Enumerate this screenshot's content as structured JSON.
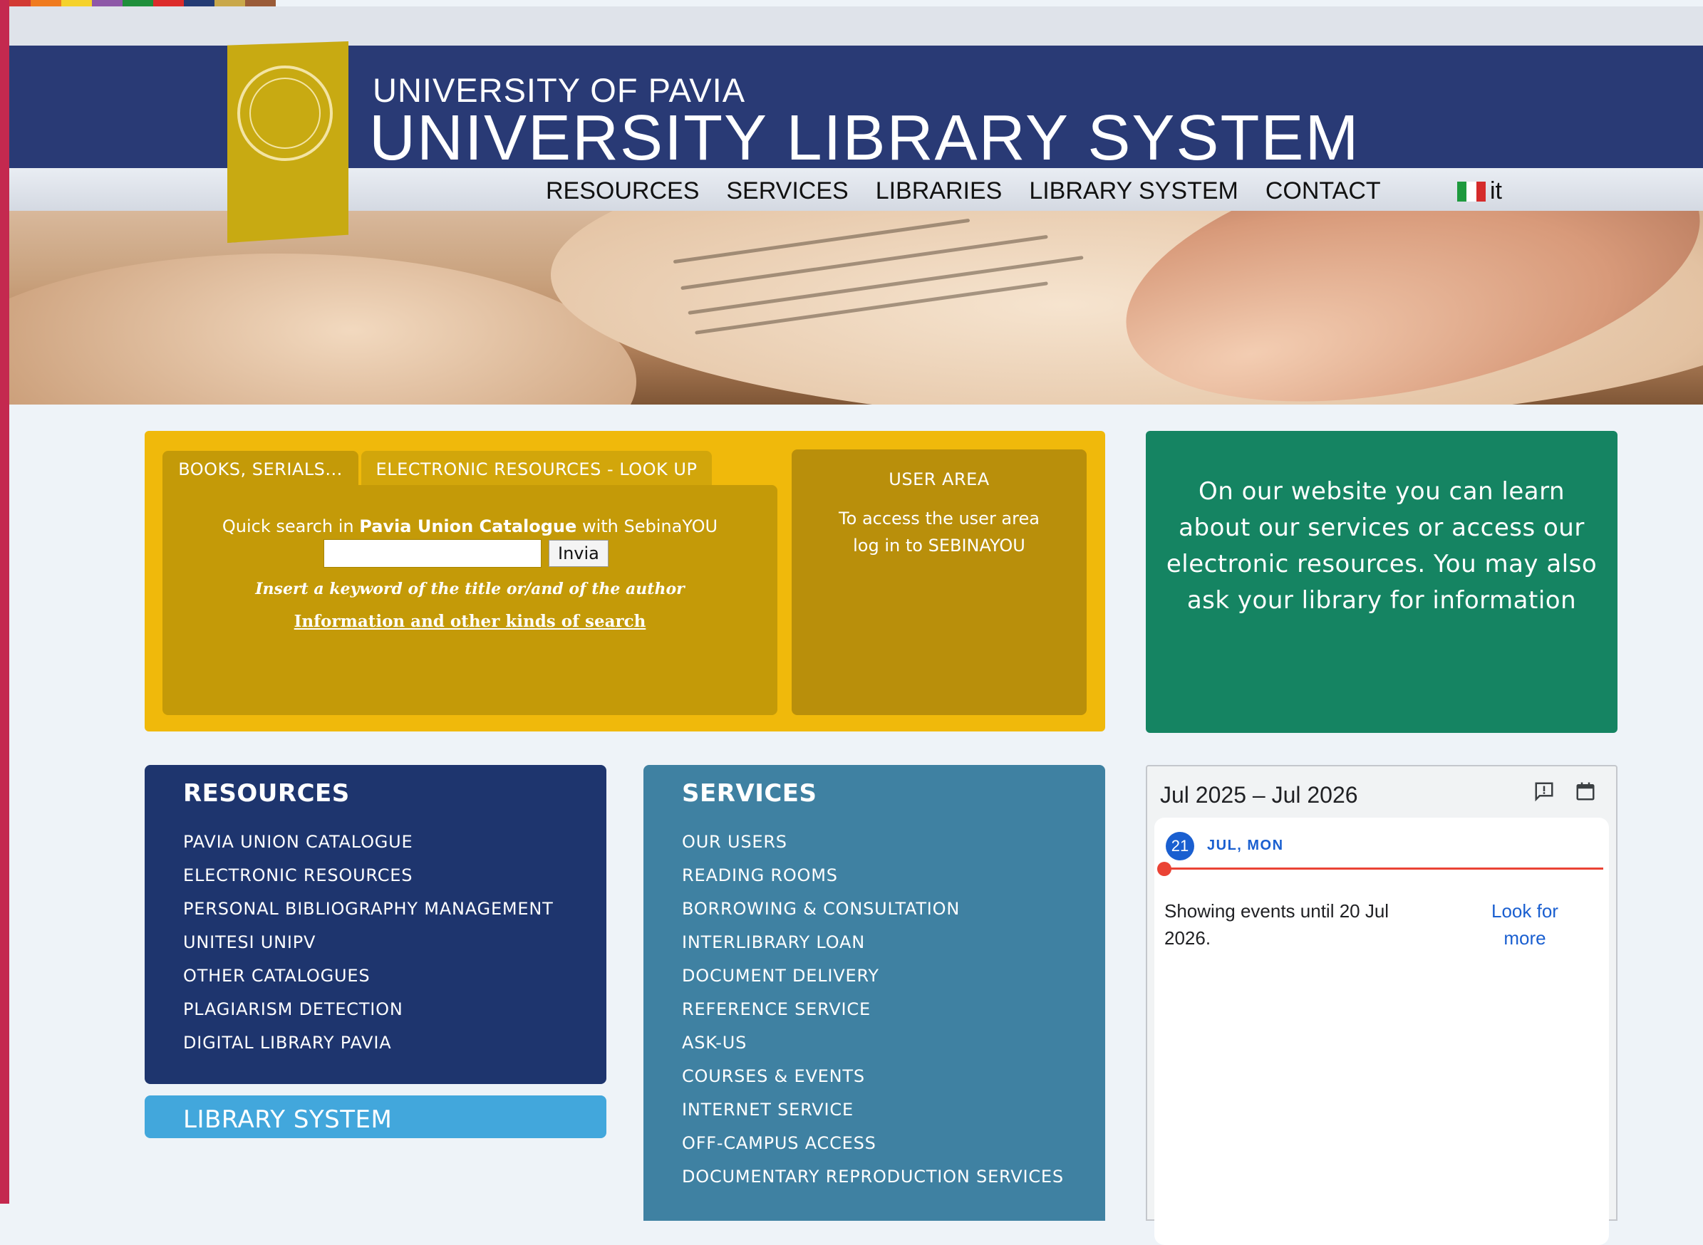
{
  "colors": {
    "header_navy": "#293a75",
    "ribbon_gold": "#c8aa12",
    "search_panel": "#f0b90b",
    "search_box": "#c49a08",
    "user_area": "#b98f0b",
    "green_card": "#158462",
    "resources_card": "#1e356e",
    "services_card": "#3f81a2",
    "library_system_card": "#42a7dc",
    "accent_bar": "#c4294f"
  },
  "rainbow_colors": [
    "#d23a34",
    "#f07b1f",
    "#f5d22b",
    "#8e58a8",
    "#1f8f3b",
    "#dc2b2b",
    "#243b74",
    "#c9a84a",
    "#9a5b38"
  ],
  "header": {
    "university": "UNIVERSITY OF PAVIA",
    "system": "UNIVERSITY LIBRARY SYSTEM",
    "seal_icon": "university-seal-icon"
  },
  "nav": {
    "items": [
      "RESOURCES",
      "SERVICES",
      "LIBRARIES",
      "LIBRARY SYSTEM",
      "CONTACT"
    ],
    "language_label": "it",
    "language_flag_icon": "italian-flag-icon"
  },
  "search": {
    "tabs": [
      "BOOKS, SERIALS...",
      "ELECTRONIC RESOURCES - LOOK UP"
    ],
    "quick_prefix": "Quick search in",
    "quick_catalogue": "Pavia Union Catalogue",
    "quick_suffix": "with SebinaYOU",
    "input_value": "",
    "button_label": "Invia",
    "hint": "Insert a keyword of the title or/and of the author",
    "info_link": "Information and other kinds of search"
  },
  "user_area": {
    "title": "USER AREA",
    "line1": "To access the user area",
    "line2": "log in to SEBINAYOU"
  },
  "green_card": {
    "text": "On our website you can learn about our services or access our electronic resources. You may also ask your library for information"
  },
  "resources": {
    "title": "RESOURCES",
    "items": [
      "PAVIA UNION CATALOGUE",
      "ELECTRONIC RESOURCES",
      "PERSONAL BIBLIOGRAPHY MANAGEMENT",
      "UNITESI UNIPV",
      "OTHER CATALOGUES",
      "PLAGIARISM DETECTION",
      "DIGITAL LIBRARY PAVIA"
    ]
  },
  "library_system": {
    "title": "LIBRARY SYSTEM"
  },
  "services": {
    "title": "SERVICES",
    "items": [
      "OUR USERS",
      "READING ROOMS",
      "BORROWING & CONSULTATION",
      "INTERLIBRARY LOAN",
      "DOCUMENT DELIVERY",
      "REFERENCE SERVICE",
      "ASK-US",
      "COURSES & EVENTS",
      "INTERNET SERVICE",
      "OFF-CAMPUS ACCESS",
      "DOCUMENTARY REPRODUCTION SERVICES"
    ]
  },
  "calendar": {
    "range": "Jul 2025 – Jul 2026",
    "feedback_icon": "feedback-icon",
    "calendar_icon": "calendar-icon",
    "day_number": "21",
    "day_label": "JUL, MON",
    "message": "Showing events until 20 Jul 2026.",
    "more_link": "Look for more"
  }
}
